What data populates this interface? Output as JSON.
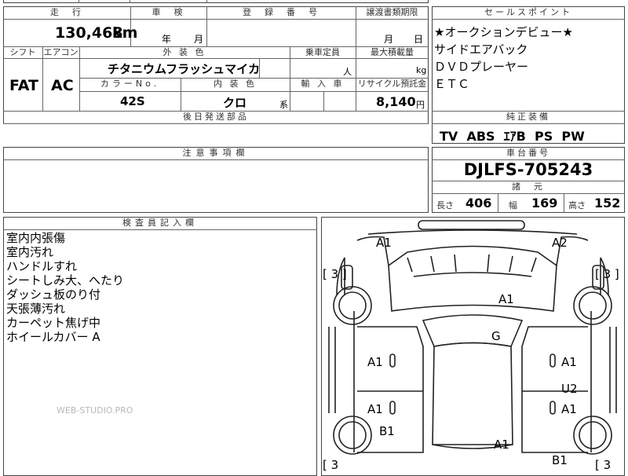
{
  "top_partial": "",
  "sheet": {
    "mileage_header": "走　行",
    "mileage_value": "130,468",
    "mileage_unit": "km",
    "inspection_header": "車　検",
    "inspection_year": "年",
    "inspection_month": "月",
    "registration_header": "登　録　番　号",
    "transfer_header": "譲渡書類期限",
    "transfer_month": "月",
    "transfer_day": "日",
    "shift_header": "シフト",
    "shift_value": "FAT",
    "aircon_header": "エアコン",
    "aircon_value": "AC",
    "exterior_color_header": "外 装 色",
    "exterior_color_value": "チタニウムフラッシュマイカ",
    "capacity_header": "乗車定員",
    "capacity_unit": "人",
    "max_load_header": "最大積載量",
    "max_load_unit": "kg",
    "color_no_header": "カラーNo.",
    "color_no_value": "42S",
    "interior_color_header": "内 装 色",
    "interior_color_value": "クロ",
    "interior_color_suffix": "系",
    "import_header": "輸 入 車",
    "recycle_header": "リサイクル預託金",
    "recycle_value": "8,140",
    "recycle_unit": "円",
    "later_parts_header": "後日発送部品",
    "notice_header": "注意事項欄",
    "inspector_header": "検査員記入欄"
  },
  "sales_points": {
    "header": "セールスポイント",
    "items": [
      "★オークションデビュー★",
      "サイドエアバック",
      "ＤＶＤプレーヤー",
      "ＥＴＣ"
    ]
  },
  "equipment": {
    "header": "純正装備",
    "items": "TV  ABS  ｴｱB  PS  PW"
  },
  "chassis": {
    "header": "車台番号",
    "number": "DJLFS-705243"
  },
  "dimensions": {
    "header": "諸　元",
    "length_label": "長さ",
    "length_value": "406",
    "width_label": "幅",
    "width_value": "169",
    "height_label": "高さ",
    "height_value": "152"
  },
  "inspector_notes": [
    "室内内張傷",
    "室内汚れ",
    "ハンドルすれ",
    "シートしみ大、へたり",
    "ダッシュ板のり付",
    "天張薄汚れ",
    "カーペット焦げ中",
    "ホイールカバー A"
  ],
  "watermark": "WEB-STUDIO.PRO",
  "diagram": {
    "marks": {
      "front_left": "A1",
      "front_right": "A2",
      "hood": "A1",
      "roof": "G",
      "left_front_door": "A1",
      "left_rear_door": "A1",
      "right_front_door": "A1",
      "right_rear_door": "A1",
      "right_rear_u": "U2",
      "left_rear_quarter": "B1",
      "trunk": "A1",
      "rear_right": "B1"
    },
    "tires": {
      "tl": "[ 3 ]",
      "tr": "[ 3 ]",
      "bl": "[ 3",
      "br": "[ 3"
    }
  }
}
